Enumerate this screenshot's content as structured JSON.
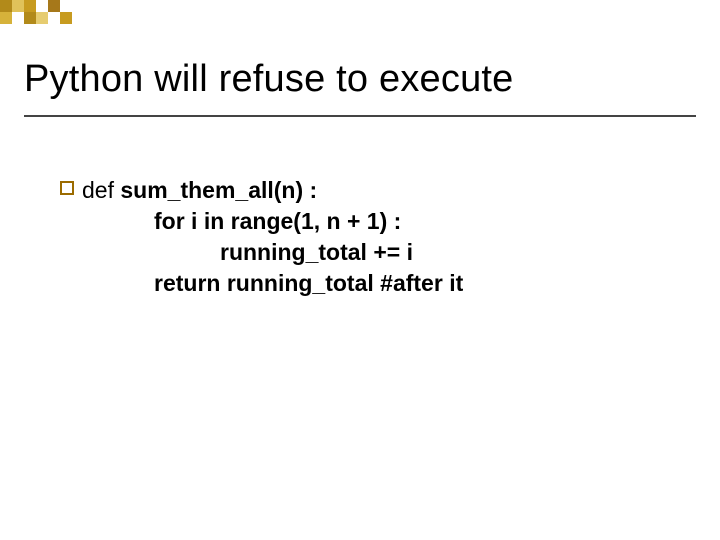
{
  "title": "Python will refuse to execute",
  "code": {
    "def_kw": "def",
    "line1_rest": " sum_them_all(n) :",
    "line2": "for i in range(1, n + 1) :",
    "line3": "running_total += i",
    "line4": "return running_total #after it"
  }
}
